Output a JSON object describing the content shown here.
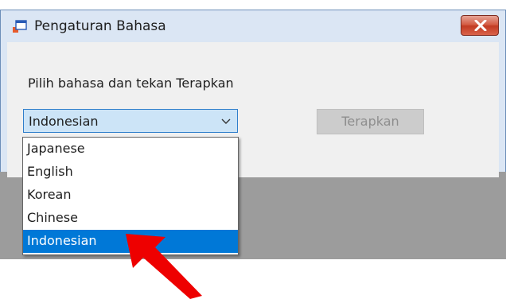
{
  "window": {
    "title": "Pengaturan Bahasa"
  },
  "dialog": {
    "prompt": "Pilih bahasa dan tekan Terapkan",
    "combo_value": "Indonesian",
    "apply_label": "Terapkan",
    "apply_enabled": false
  },
  "dropdown": {
    "items": [
      {
        "label": "Japanese"
      },
      {
        "label": "English"
      },
      {
        "label": "Korean"
      },
      {
        "label": "Chinese"
      },
      {
        "label": "Indonesian"
      }
    ],
    "selected_index": 4
  },
  "colors": {
    "selection": "#0078d7",
    "combo_background": "#cce4f7",
    "combo_border": "#2f7ecb",
    "annotation_arrow": "#ee0000"
  }
}
